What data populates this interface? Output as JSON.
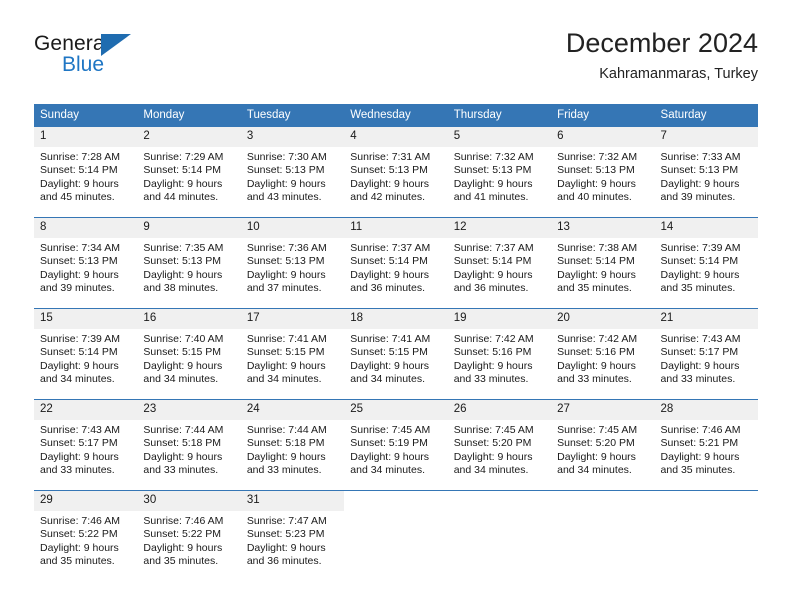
{
  "logo": {
    "word_top": "General",
    "word_bottom": "Blue",
    "triangle_color": "#1f6cb0",
    "blue_text_color": "#1f76c4"
  },
  "header": {
    "title": "December 2024",
    "subtitle": "Kahramanmaras, Turkey"
  },
  "theme": {
    "header_blue": "#3576b5",
    "daynum_bg": "#f0f0f0"
  },
  "weekdays": [
    "Sunday",
    "Monday",
    "Tuesday",
    "Wednesday",
    "Thursday",
    "Friday",
    "Saturday"
  ],
  "weeks": [
    [
      {
        "day": "1",
        "sunrise": "Sunrise: 7:28 AM",
        "sunset": "Sunset: 5:14 PM",
        "daylight1": "Daylight: 9 hours",
        "daylight2": "and 45 minutes."
      },
      {
        "day": "2",
        "sunrise": "Sunrise: 7:29 AM",
        "sunset": "Sunset: 5:14 PM",
        "daylight1": "Daylight: 9 hours",
        "daylight2": "and 44 minutes."
      },
      {
        "day": "3",
        "sunrise": "Sunrise: 7:30 AM",
        "sunset": "Sunset: 5:13 PM",
        "daylight1": "Daylight: 9 hours",
        "daylight2": "and 43 minutes."
      },
      {
        "day": "4",
        "sunrise": "Sunrise: 7:31 AM",
        "sunset": "Sunset: 5:13 PM",
        "daylight1": "Daylight: 9 hours",
        "daylight2": "and 42 minutes."
      },
      {
        "day": "5",
        "sunrise": "Sunrise: 7:32 AM",
        "sunset": "Sunset: 5:13 PM",
        "daylight1": "Daylight: 9 hours",
        "daylight2": "and 41 minutes."
      },
      {
        "day": "6",
        "sunrise": "Sunrise: 7:32 AM",
        "sunset": "Sunset: 5:13 PM",
        "daylight1": "Daylight: 9 hours",
        "daylight2": "and 40 minutes."
      },
      {
        "day": "7",
        "sunrise": "Sunrise: 7:33 AM",
        "sunset": "Sunset: 5:13 PM",
        "daylight1": "Daylight: 9 hours",
        "daylight2": "and 39 minutes."
      }
    ],
    [
      {
        "day": "8",
        "sunrise": "Sunrise: 7:34 AM",
        "sunset": "Sunset: 5:13 PM",
        "daylight1": "Daylight: 9 hours",
        "daylight2": "and 39 minutes."
      },
      {
        "day": "9",
        "sunrise": "Sunrise: 7:35 AM",
        "sunset": "Sunset: 5:13 PM",
        "daylight1": "Daylight: 9 hours",
        "daylight2": "and 38 minutes."
      },
      {
        "day": "10",
        "sunrise": "Sunrise: 7:36 AM",
        "sunset": "Sunset: 5:13 PM",
        "daylight1": "Daylight: 9 hours",
        "daylight2": "and 37 minutes."
      },
      {
        "day": "11",
        "sunrise": "Sunrise: 7:37 AM",
        "sunset": "Sunset: 5:14 PM",
        "daylight1": "Daylight: 9 hours",
        "daylight2": "and 36 minutes."
      },
      {
        "day": "12",
        "sunrise": "Sunrise: 7:37 AM",
        "sunset": "Sunset: 5:14 PM",
        "daylight1": "Daylight: 9 hours",
        "daylight2": "and 36 minutes."
      },
      {
        "day": "13",
        "sunrise": "Sunrise: 7:38 AM",
        "sunset": "Sunset: 5:14 PM",
        "daylight1": "Daylight: 9 hours",
        "daylight2": "and 35 minutes."
      },
      {
        "day": "14",
        "sunrise": "Sunrise: 7:39 AM",
        "sunset": "Sunset: 5:14 PM",
        "daylight1": "Daylight: 9 hours",
        "daylight2": "and 35 minutes."
      }
    ],
    [
      {
        "day": "15",
        "sunrise": "Sunrise: 7:39 AM",
        "sunset": "Sunset: 5:14 PM",
        "daylight1": "Daylight: 9 hours",
        "daylight2": "and 34 minutes."
      },
      {
        "day": "16",
        "sunrise": "Sunrise: 7:40 AM",
        "sunset": "Sunset: 5:15 PM",
        "daylight1": "Daylight: 9 hours",
        "daylight2": "and 34 minutes."
      },
      {
        "day": "17",
        "sunrise": "Sunrise: 7:41 AM",
        "sunset": "Sunset: 5:15 PM",
        "daylight1": "Daylight: 9 hours",
        "daylight2": "and 34 minutes."
      },
      {
        "day": "18",
        "sunrise": "Sunrise: 7:41 AM",
        "sunset": "Sunset: 5:15 PM",
        "daylight1": "Daylight: 9 hours",
        "daylight2": "and 34 minutes."
      },
      {
        "day": "19",
        "sunrise": "Sunrise: 7:42 AM",
        "sunset": "Sunset: 5:16 PM",
        "daylight1": "Daylight: 9 hours",
        "daylight2": "and 33 minutes."
      },
      {
        "day": "20",
        "sunrise": "Sunrise: 7:42 AM",
        "sunset": "Sunset: 5:16 PM",
        "daylight1": "Daylight: 9 hours",
        "daylight2": "and 33 minutes."
      },
      {
        "day": "21",
        "sunrise": "Sunrise: 7:43 AM",
        "sunset": "Sunset: 5:17 PM",
        "daylight1": "Daylight: 9 hours",
        "daylight2": "and 33 minutes."
      }
    ],
    [
      {
        "day": "22",
        "sunrise": "Sunrise: 7:43 AM",
        "sunset": "Sunset: 5:17 PM",
        "daylight1": "Daylight: 9 hours",
        "daylight2": "and 33 minutes."
      },
      {
        "day": "23",
        "sunrise": "Sunrise: 7:44 AM",
        "sunset": "Sunset: 5:18 PM",
        "daylight1": "Daylight: 9 hours",
        "daylight2": "and 33 minutes."
      },
      {
        "day": "24",
        "sunrise": "Sunrise: 7:44 AM",
        "sunset": "Sunset: 5:18 PM",
        "daylight1": "Daylight: 9 hours",
        "daylight2": "and 33 minutes."
      },
      {
        "day": "25",
        "sunrise": "Sunrise: 7:45 AM",
        "sunset": "Sunset: 5:19 PM",
        "daylight1": "Daylight: 9 hours",
        "daylight2": "and 34 minutes."
      },
      {
        "day": "26",
        "sunrise": "Sunrise: 7:45 AM",
        "sunset": "Sunset: 5:20 PM",
        "daylight1": "Daylight: 9 hours",
        "daylight2": "and 34 minutes."
      },
      {
        "day": "27",
        "sunrise": "Sunrise: 7:45 AM",
        "sunset": "Sunset: 5:20 PM",
        "daylight1": "Daylight: 9 hours",
        "daylight2": "and 34 minutes."
      },
      {
        "day": "28",
        "sunrise": "Sunrise: 7:46 AM",
        "sunset": "Sunset: 5:21 PM",
        "daylight1": "Daylight: 9 hours",
        "daylight2": "and 35 minutes."
      }
    ],
    [
      {
        "day": "29",
        "sunrise": "Sunrise: 7:46 AM",
        "sunset": "Sunset: 5:22 PM",
        "daylight1": "Daylight: 9 hours",
        "daylight2": "and 35 minutes."
      },
      {
        "day": "30",
        "sunrise": "Sunrise: 7:46 AM",
        "sunset": "Sunset: 5:22 PM",
        "daylight1": "Daylight: 9 hours",
        "daylight2": "and 35 minutes."
      },
      {
        "day": "31",
        "sunrise": "Sunrise: 7:47 AM",
        "sunset": "Sunset: 5:23 PM",
        "daylight1": "Daylight: 9 hours",
        "daylight2": "and 36 minutes."
      },
      {
        "day": "",
        "sunrise": "",
        "sunset": "",
        "daylight1": "",
        "daylight2": ""
      },
      {
        "day": "",
        "sunrise": "",
        "sunset": "",
        "daylight1": "",
        "daylight2": ""
      },
      {
        "day": "",
        "sunrise": "",
        "sunset": "",
        "daylight1": "",
        "daylight2": ""
      },
      {
        "day": "",
        "sunrise": "",
        "sunset": "",
        "daylight1": "",
        "daylight2": ""
      }
    ]
  ]
}
